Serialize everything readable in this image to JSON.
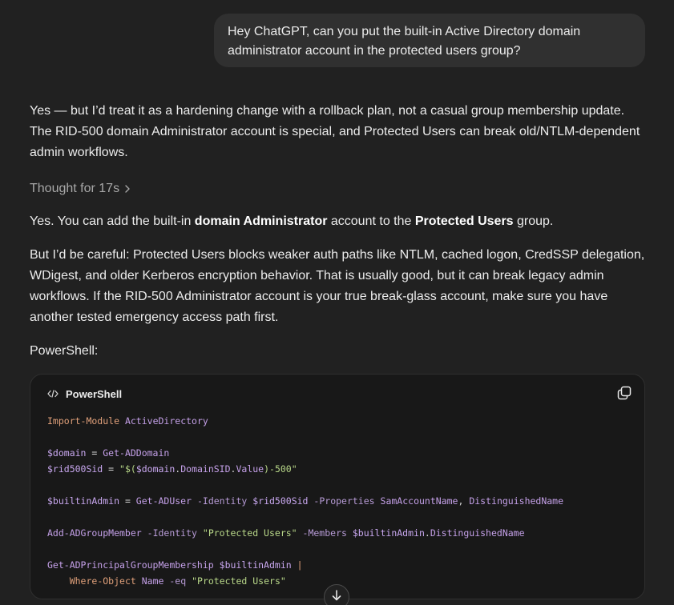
{
  "user_message": {
    "line1": "Hey ChatGPT, can you put the built-in Active Directory domain",
    "line2": "administrator account in the protected users group?"
  },
  "assistant": {
    "intro": {
      "line1": "Yes — but I’d treat it as a hardening change with a rollback plan, not a casual group membership update.",
      "line2": "The RID-500 domain Administrator account is special, and Protected Users can break old/NTLM-dependent",
      "line3": "admin workflows."
    },
    "thought_label": "Thought for 17s",
    "answer": {
      "p1_a": "Yes. You can add the built-in ",
      "p1_b": "domain Administrator",
      "p1_c": " account to the ",
      "p1_d": "Protected Users",
      "p1_e": " group.",
      "p2_line1": "But I’d be careful: Protected Users blocks weaker auth paths like NTLM, cached logon, CredSSP delegation,",
      "p2_line2": "WDigest, and older Kerberos encryption behavior. That is usually good, but it can break legacy admin",
      "p2_line3": "workflows. If the RID-500 Administrator account is your true break-glass account, make sure you have",
      "p2_line4": "another tested emergency access path first.",
      "p3": "PowerShell:"
    },
    "code_block": {
      "language": "PowerShell",
      "copy_icon": "copy-icon",
      "lines": [
        {
          "tokens": [
            {
              "cls": "k",
              "text": "Import-Module"
            },
            {
              "cls": "t",
              "text": " "
            },
            {
              "cls": "c",
              "text": "ActiveDirectory"
            }
          ]
        },
        {
          "tokens": []
        },
        {
          "tokens": [
            {
              "cls": "v",
              "text": "$domain"
            },
            {
              "cls": "t",
              "text": " = "
            },
            {
              "cls": "c",
              "text": "Get-ADDomain"
            }
          ]
        },
        {
          "tokens": [
            {
              "cls": "v",
              "text": "$rid500Sid"
            },
            {
              "cls": "t",
              "text": " = "
            },
            {
              "cls": "s",
              "text": "\"$("
            },
            {
              "cls": "v",
              "text": "$domain"
            },
            {
              "cls": "t",
              "text": "."
            },
            {
              "cls": "c",
              "text": "DomainSID"
            },
            {
              "cls": "t",
              "text": "."
            },
            {
              "cls": "c",
              "text": "Value"
            },
            {
              "cls": "s",
              "text": ")-500\""
            }
          ]
        },
        {
          "tokens": []
        },
        {
          "tokens": [
            {
              "cls": "v",
              "text": "$builtinAdmin"
            },
            {
              "cls": "t",
              "text": " = "
            },
            {
              "cls": "c",
              "text": "Get-ADUser"
            },
            {
              "cls": "t",
              "text": " "
            },
            {
              "cls": "p",
              "text": "-Identity"
            },
            {
              "cls": "t",
              "text": " "
            },
            {
              "cls": "v",
              "text": "$rid500Sid"
            },
            {
              "cls": "t",
              "text": " "
            },
            {
              "cls": "p",
              "text": "-Properties"
            },
            {
              "cls": "t",
              "text": " "
            },
            {
              "cls": "c",
              "text": "SamAccountName"
            },
            {
              "cls": "t",
              "text": ", "
            },
            {
              "cls": "c",
              "text": "DistinguishedName"
            }
          ]
        },
        {
          "tokens": []
        },
        {
          "tokens": [
            {
              "cls": "c",
              "text": "Add-ADGroupMember"
            },
            {
              "cls": "t",
              "text": " "
            },
            {
              "cls": "p",
              "text": "-Identity"
            },
            {
              "cls": "t",
              "text": " "
            },
            {
              "cls": "s",
              "text": "\"Protected Users\""
            },
            {
              "cls": "t",
              "text": " "
            },
            {
              "cls": "p",
              "text": "-Members"
            },
            {
              "cls": "t",
              "text": " "
            },
            {
              "cls": "v",
              "text": "$builtinAdmin"
            },
            {
              "cls": "t",
              "text": "."
            },
            {
              "cls": "c",
              "text": "DistinguishedName"
            }
          ]
        },
        {
          "tokens": []
        },
        {
          "tokens": [
            {
              "cls": "c",
              "text": "Get-ADPrincipalGroupMembership"
            },
            {
              "cls": "t",
              "text": " "
            },
            {
              "cls": "v",
              "text": "$builtinAdmin"
            },
            {
              "cls": "t",
              "text": " "
            },
            {
              "cls": "k",
              "text": "|"
            }
          ]
        },
        {
          "tokens": [
            {
              "cls": "t",
              "text": "    "
            },
            {
              "cls": "k",
              "text": "Where-Object"
            },
            {
              "cls": "t",
              "text": " "
            },
            {
              "cls": "c",
              "text": "Name"
            },
            {
              "cls": "t",
              "text": " "
            },
            {
              "cls": "p",
              "text": "-eq"
            },
            {
              "cls": "t",
              "text": " "
            },
            {
              "cls": "s",
              "text": "\"Protected Users\""
            }
          ]
        }
      ]
    }
  },
  "icons": {
    "chevron": "chevron-right-icon",
    "code": "code-icon",
    "scroll": "arrow-down-icon"
  },
  "colors": {
    "background": "#212121",
    "user_bubble": "#303030",
    "code_bg": "#181818"
  }
}
